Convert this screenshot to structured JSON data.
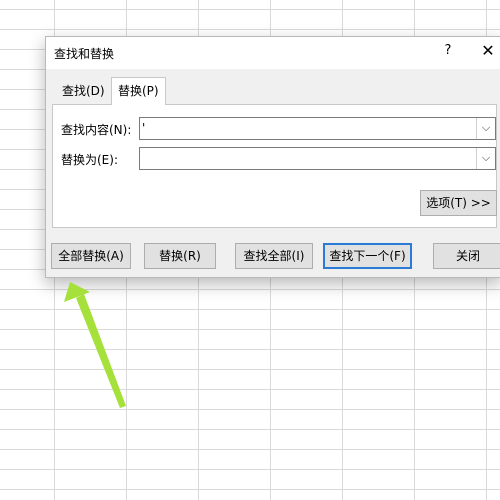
{
  "dialog": {
    "title": "查找和替换",
    "help_glyph": "?",
    "close_glyph": "✕"
  },
  "tabs": [
    {
      "label": "查找(D)",
      "active": false
    },
    {
      "label": "替换(P)",
      "active": true
    }
  ],
  "fields": {
    "find_label": "查找内容(N):",
    "find_value": "'",
    "replace_label": "替换为(E):",
    "replace_value": ""
  },
  "buttons": {
    "options": "选项(T) >>",
    "replace_all": "全部替换(A)",
    "replace": "替换(R)",
    "find_all": "查找全部(I)",
    "find_next": "查找下一个(F)",
    "close": "关闭"
  },
  "colors": {
    "arrow": "#a6e03a",
    "default_button_border": "#2b7bd6"
  }
}
